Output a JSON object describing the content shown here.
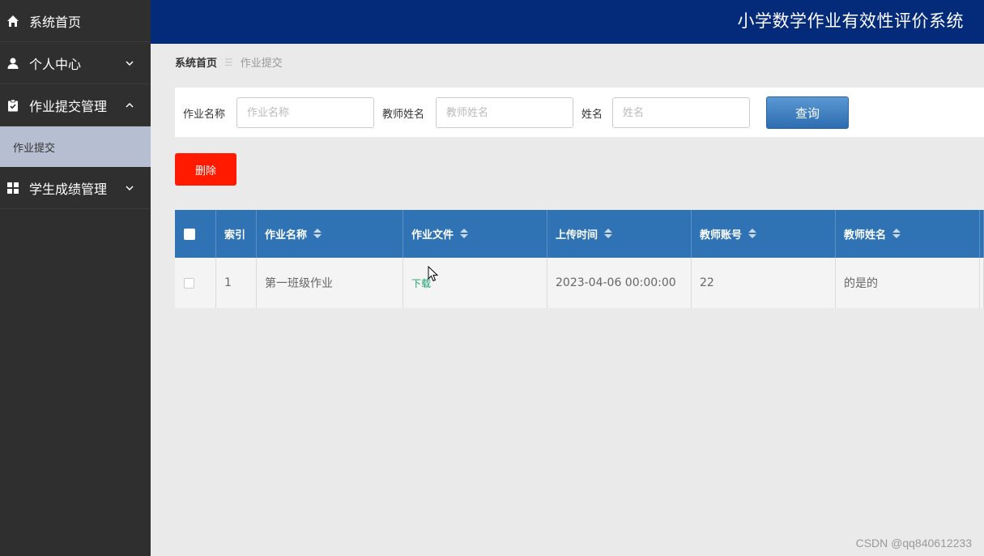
{
  "sidebar": {
    "items": [
      {
        "label": "系统首页",
        "icon": "home-icon"
      },
      {
        "label": "个人中心",
        "icon": "user-icon"
      },
      {
        "label": "作业提交管理",
        "icon": "clipboard-check-icon"
      },
      {
        "label": "学生成绩管理",
        "icon": "grid-icon"
      }
    ],
    "sub_item": "作业提交"
  },
  "header": {
    "title": "小学数学作业有效性评价系统"
  },
  "breadcrumb": {
    "home": "系统首页",
    "separator": "☰",
    "current": "作业提交"
  },
  "search": {
    "fields": [
      {
        "label": "作业名称",
        "placeholder": "作业名称"
      },
      {
        "label": "教师姓名",
        "placeholder": "教师姓名"
      },
      {
        "label": "姓名",
        "placeholder": "姓名"
      }
    ],
    "query_label": "查询"
  },
  "actions": {
    "delete_label": "删除"
  },
  "table": {
    "columns": [
      "索引",
      "作业名称",
      "作业文件",
      "上传时间",
      "教师账号",
      "教师姓名"
    ],
    "rows": [
      {
        "index": "1",
        "name": "第一班级作业",
        "file": "下载",
        "time": "2023-04-06 00:00:00",
        "teacher_account": "22",
        "teacher_name": "的是的"
      }
    ]
  },
  "watermark": "CSDN @qq840612233",
  "colors": {
    "sidebar": "#2f2f2f",
    "header": "#042a7a",
    "table_header": "#2f73b4",
    "query_button": "#3a7cc0",
    "delete_button": "#ff1a00",
    "active_sub": "#b6bfd1"
  }
}
